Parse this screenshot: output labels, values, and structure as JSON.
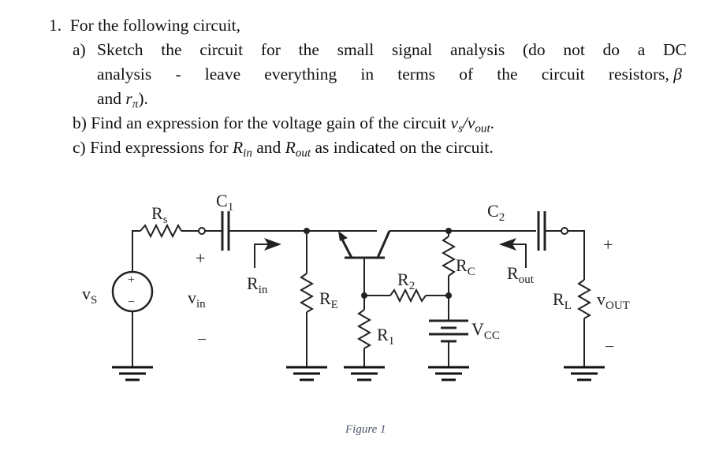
{
  "question": {
    "number": "1.",
    "intro": "For the following circuit,",
    "parts": [
      {
        "label": "a)",
        "line1_words": [
          "Sketch",
          "the",
          "circuit",
          "for",
          "the",
          "small",
          "signal",
          "analysis",
          "(do",
          "not",
          "do",
          "a",
          "DC"
        ],
        "line2_words": [
          "analysis",
          "-",
          "leave",
          "everything",
          "in",
          "terms",
          "of",
          "the",
          "circuit",
          "resistors, β"
        ],
        "line3": "and ",
        "line3_math": "r",
        "line3_sub": "π",
        "line3_end": ")."
      },
      {
        "label": "b)",
        "text": "Find an expression for the voltage gain of the circuit ",
        "math_a": "v",
        "math_a_sub": "s",
        "slash": "/",
        "math_b": "v",
        "math_b_sub": "out",
        "end": "."
      },
      {
        "label": "c)",
        "text1": "Find expressions for ",
        "rin": "R",
        "rin_sub": "in",
        "text2": " and ",
        "rout": "R",
        "rout_sub": "out",
        "text3": " as indicated on the circuit."
      }
    ]
  },
  "circuit": {
    "labels": {
      "rs": "R",
      "rs_sub": "s",
      "c1": "C",
      "c1_sub": "1",
      "c2": "C",
      "c2_sub": "2",
      "vs": "v",
      "vs_sub": "S",
      "vin": "v",
      "vin_sub": "in",
      "vin_plus": "+",
      "vin_minus": "−",
      "rin": "R",
      "rin_sub": "in",
      "re": "R",
      "re_sub": "E",
      "r1": "R",
      "r1_sub": "1",
      "r2": "R",
      "r2_sub": "2",
      "rc": "R",
      "rc_sub": "C",
      "rout": "R",
      "rout_sub": "out",
      "vcc": "V",
      "vcc_sub": "CC",
      "rl": "R",
      "rl_sub": "L",
      "vout": "v",
      "vout_sub": "OUT",
      "vout_plus": "+",
      "vout_minus": "−",
      "src_plus": "+",
      "src_minus": "−"
    },
    "caption": "Figure 1"
  }
}
